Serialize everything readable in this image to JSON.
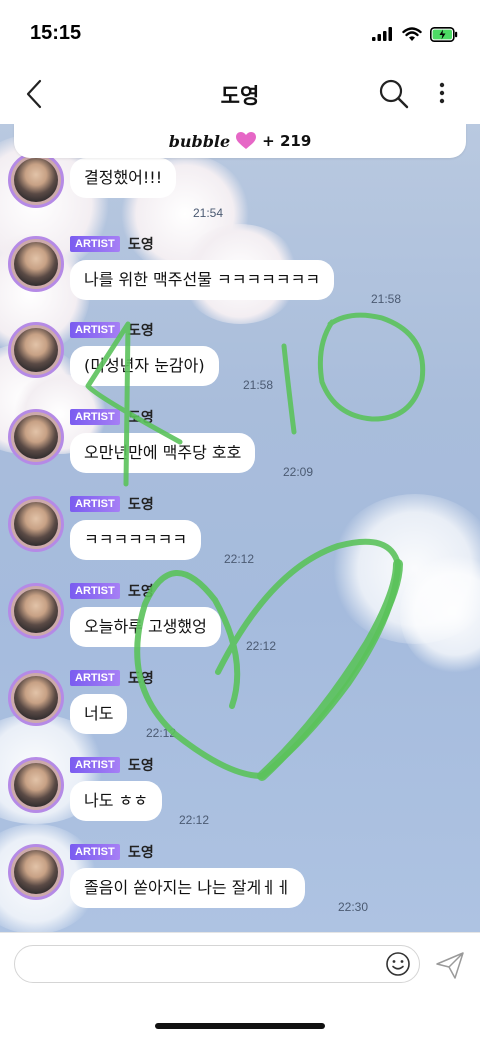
{
  "status_bar": {
    "time": "15:15",
    "battery_charging": true
  },
  "header": {
    "title": "도영",
    "back_icon": "chevron-left-icon",
    "search_icon": "search-icon",
    "more_icon": "more-vertical-icon"
  },
  "subscriber_bar": {
    "logo": "bubble",
    "heart_color": "#e667c6",
    "count": "+ 219"
  },
  "messages": [
    {
      "badge": "ARTIST",
      "name": "도영",
      "text": "결정했어!!!",
      "time": "21:54"
    },
    {
      "badge": "ARTIST",
      "name": "도영",
      "text": "나를 위한 맥주선물 ㅋㅋㅋㅋㅋㅋㅋ",
      "time": "21:58"
    },
    {
      "badge": "ARTIST",
      "name": "도영",
      "text": "(미성년자 눈감아)",
      "time": "21:58"
    },
    {
      "badge": "ARTIST",
      "name": "도영",
      "text": "오만년만에 맥주당 호호",
      "time": "22:09"
    },
    {
      "badge": "ARTIST",
      "name": "도영",
      "text": "ㅋㅋㅋㅋㅋㅋㅋ",
      "time": "22:12"
    },
    {
      "badge": "ARTIST",
      "name": "도영",
      "text": "오늘하루 고생했엉",
      "time": "22:12"
    },
    {
      "badge": "ARTIST",
      "name": "도영",
      "text": "너도",
      "time": "22:12"
    },
    {
      "badge": "ARTIST",
      "name": "도영",
      "text": "나도 ㅎㅎ",
      "time": "22:12"
    },
    {
      "badge": "ARTIST",
      "name": "도영",
      "text": "졸음이 쏟아지는 나는 잘게ㅔㅔ",
      "time": "22:30"
    }
  ],
  "doodle": {
    "color": "#5bc25b",
    "drawn_shapes": [
      "number-4",
      "number-1",
      "number-0",
      "heart"
    ]
  },
  "input": {
    "placeholder": "",
    "emoji_icon": "smiley-icon",
    "send_icon": "send-icon"
  },
  "colors": {
    "accent": "#8a63ef",
    "avatar_ring": "#b58ae6",
    "chat_bg": "#a9bddb"
  }
}
